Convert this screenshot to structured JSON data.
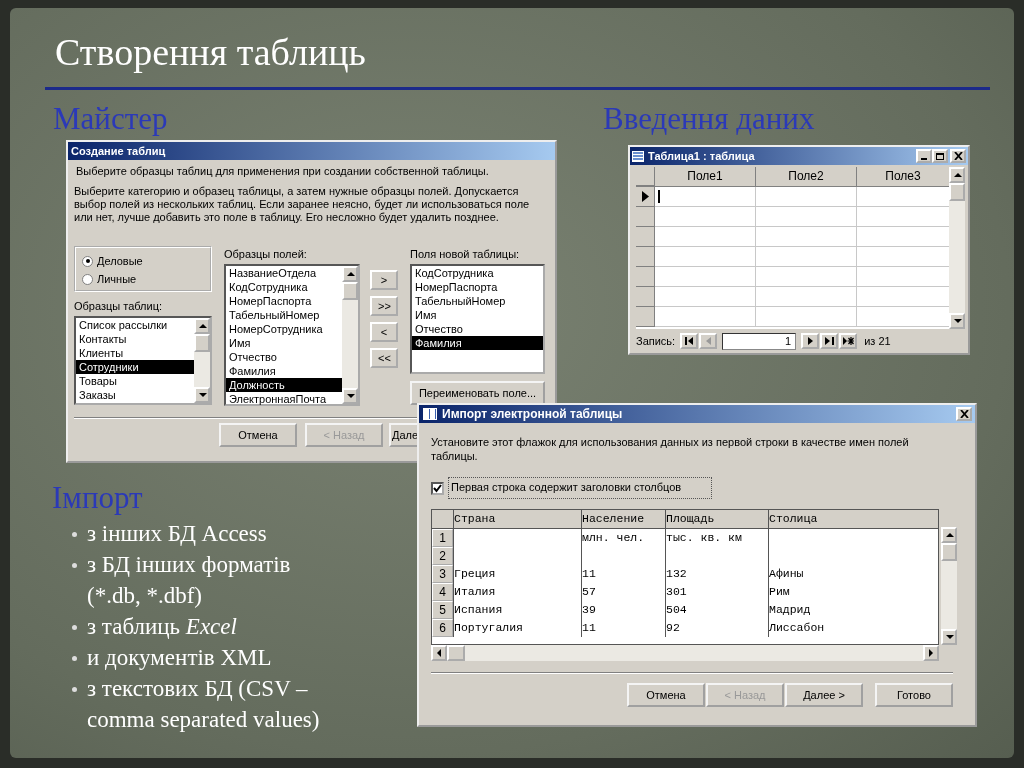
{
  "slide": {
    "title": "Створення таблиць",
    "wizard_heading": "Майстер",
    "data_entry_heading": "Введення даних",
    "import_heading": "Імпорт",
    "import_bullets": [
      "з інших БД Access",
      "з БД інших форматів (*.db, *.dbf)",
      "з таблиць *Excel*",
      "и документів XML",
      "з текстових БД (CSV – comma separated values)"
    ]
  },
  "wizard": {
    "title": "Создание таблиц",
    "intro": "Выберите образцы таблиц для применения при создании собственной таблицы.",
    "description": "Выберите категорию и образец таблицы, а затем нужные образцы полей. Допускается выбор полей из нескольких таблиц. Если заранее неясно, будет ли использоваться поле или нет, лучше добавить это поле в таблицу. Его несложно будет удалить позднее.",
    "categories": [
      {
        "label": "Деловые",
        "selected": true
      },
      {
        "label": "Личные",
        "selected": false
      }
    ],
    "samples_label": "Образцы таблиц:",
    "samples": [
      {
        "label": "Список рассылки",
        "selected": false
      },
      {
        "label": "Контакты",
        "selected": false
      },
      {
        "label": "Клиенты",
        "selected": false
      },
      {
        "label": "Сотрудники",
        "selected": true
      },
      {
        "label": "Товары",
        "selected": false
      },
      {
        "label": "Заказы",
        "selected": false
      }
    ],
    "fields_label": "Образцы полей:",
    "fields": [
      {
        "label": "НазваниеОтдела",
        "selected": false
      },
      {
        "label": "КодСотрудника",
        "selected": false
      },
      {
        "label": "НомерПаспорта",
        "selected": false
      },
      {
        "label": "ТабельныйНомер",
        "selected": false
      },
      {
        "label": "НомерСотрудника",
        "selected": false
      },
      {
        "label": "Имя",
        "selected": false
      },
      {
        "label": "Отчество",
        "selected": false
      },
      {
        "label": "Фамилия",
        "selected": false
      },
      {
        "label": "Должность",
        "selected": true
      },
      {
        "label": "ЭлектроннаяПочта",
        "selected": false
      }
    ],
    "move_buttons": [
      ">",
      ">>",
      "<",
      "<<"
    ],
    "new_fields_label": "Поля новой таблицы:",
    "new_fields": [
      {
        "label": "КодСотрудника",
        "selected": false
      },
      {
        "label": "НомерПаспорта",
        "selected": false
      },
      {
        "label": "ТабельныйНомер",
        "selected": false
      },
      {
        "label": "Имя",
        "selected": false
      },
      {
        "label": "Отчество",
        "selected": false
      },
      {
        "label": "Фамилия",
        "selected": true
      }
    ],
    "rename_button": "Переименовать поле...",
    "buttons": [
      {
        "label": "Отмена",
        "disabled": false
      },
      {
        "label": "< Назад",
        "disabled": true
      },
      {
        "label": "Дале",
        "disabled": false
      }
    ]
  },
  "datasheet": {
    "title": "Таблица1 : таблица",
    "columns": [
      "Поле1",
      "Поле2",
      "Поле3"
    ],
    "rows": [
      {
        "current": true
      },
      {
        "current": false
      },
      {
        "current": false
      },
      {
        "current": false
      },
      {
        "current": false
      },
      {
        "current": false
      },
      {
        "current": false
      }
    ],
    "navigator": {
      "label": "Запись:",
      "record": "1",
      "total": "из 21"
    }
  },
  "import": {
    "title": "Импорт электронной таблицы",
    "instruction": "Установите этот флажок для использования данных из первой строки в качестве имен полей таблицы.",
    "checkbox": {
      "label": "Первая строка содержит заголовки столбцов",
      "checked": true
    },
    "columns": [
      "Страна",
      "Население",
      "Площадь",
      "Столица"
    ],
    "rows": [
      {
        "number": "1",
        "cells": [
          null,
          "млн. чел.",
          "тыс. кв. км",
          null
        ]
      },
      {
        "number": "2",
        "cells": [
          null,
          null,
          null,
          null
        ]
      },
      {
        "number": "3",
        "cells": [
          "Греция",
          "11",
          "132",
          "Афины"
        ]
      },
      {
        "number": "4",
        "cells": [
          "Италия",
          "57",
          "301",
          "Рим"
        ]
      },
      {
        "number": "5",
        "cells": [
          "Испания",
          "39",
          "504",
          "Мадрид"
        ]
      },
      {
        "number": "6",
        "cells": [
          "Португалия",
          "11",
          "92",
          "Лиссабон"
        ]
      }
    ],
    "buttons": [
      {
        "label": "Отмена",
        "disabled": false
      },
      {
        "label": "< Назад",
        "disabled": true
      },
      {
        "label": "Далее >",
        "disabled": false
      },
      {
        "label": "Готово",
        "disabled": false
      }
    ]
  }
}
